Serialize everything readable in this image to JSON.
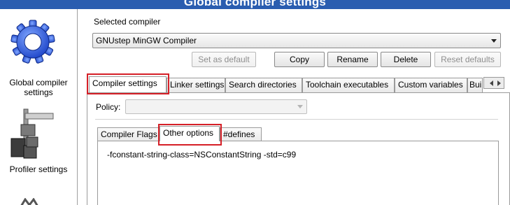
{
  "window": {
    "title": "Global compiler settings"
  },
  "sidebar": {
    "items": [
      {
        "label_line1": "Global compiler",
        "label_line2": "settings",
        "icon": "gear-icon"
      },
      {
        "label_line1": "Profiler settings",
        "label_line2": "",
        "icon": "caliper-icon"
      },
      {
        "label_line1": "",
        "label_line2": "",
        "icon": "partial-icon"
      }
    ]
  },
  "compiler": {
    "selected_label": "Selected compiler",
    "selected_value": "GNUstep MinGW Compiler",
    "buttons": {
      "set_default": "Set as default",
      "copy": "Copy",
      "rename": "Rename",
      "delete": "Delete",
      "reset_defaults": "Reset defaults"
    }
  },
  "tabs": [
    {
      "label": "Compiler settings",
      "active": true
    },
    {
      "label": "Linker settings",
      "active": false
    },
    {
      "label": "Search directories",
      "active": false
    },
    {
      "label": "Toolchain executables",
      "active": false
    },
    {
      "label": "Custom variables",
      "active": false
    },
    {
      "label": "Bui",
      "active": false
    }
  ],
  "policy": {
    "label": "Policy:",
    "value": ""
  },
  "subtabs": [
    {
      "label": "Compiler Flags",
      "active": false
    },
    {
      "label": "Other options",
      "active": true
    },
    {
      "label": "#defines",
      "active": false
    }
  ],
  "other_options": {
    "text": "-fconstant-string-class=NSConstantString -std=c99"
  },
  "colors": {
    "title_bar": "#2a5db0",
    "highlight": "#d51f27"
  }
}
